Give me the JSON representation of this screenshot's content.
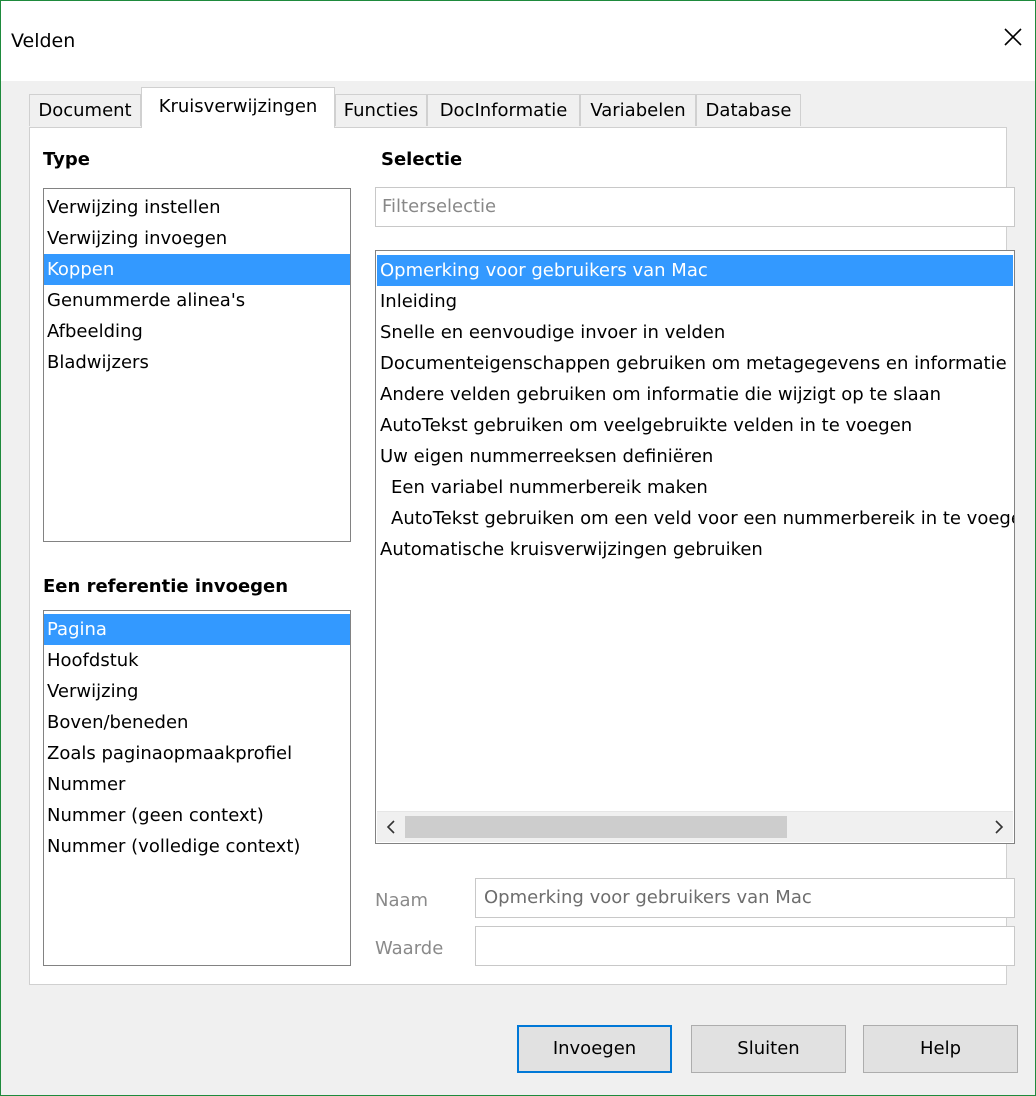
{
  "window": {
    "title": "Velden"
  },
  "tabs": [
    {
      "label": "Document"
    },
    {
      "label": "Kruisverwijzingen"
    },
    {
      "label": "Functies"
    },
    {
      "label": "DocInformatie"
    },
    {
      "label": "Variabelen"
    },
    {
      "label": "Database"
    }
  ],
  "active_tab": "Kruisverwijzingen",
  "type_section": {
    "heading": "Type",
    "items": [
      {
        "label": "Verwijzing instellen"
      },
      {
        "label": "Verwijzing invoegen"
      },
      {
        "label": "Koppen"
      },
      {
        "label": "Genummerde alinea's"
      },
      {
        "label": "Afbeelding"
      },
      {
        "label": "Bladwijzers"
      }
    ],
    "selected": "Koppen"
  },
  "insert_ref_section": {
    "heading": "Een referentie invoegen",
    "items": [
      {
        "label": "Pagina"
      },
      {
        "label": "Hoofdstuk"
      },
      {
        "label": "Verwijzing"
      },
      {
        "label": "Boven/beneden"
      },
      {
        "label": "Zoals paginaopmaakprofiel"
      },
      {
        "label": "Nummer"
      },
      {
        "label": "Nummer (geen context)"
      },
      {
        "label": "Nummer (volledige context)"
      }
    ],
    "selected": "Pagina"
  },
  "selection_section": {
    "heading": "Selectie",
    "filter_placeholder": "Filterselectie",
    "items": [
      {
        "label": "Opmerking voor gebruikers van Mac"
      },
      {
        "label": "Inleiding"
      },
      {
        "label": "Snelle en eenvoudige invoer in velden"
      },
      {
        "label": "Documenteigenschappen gebruiken om metagegevens en informatie"
      },
      {
        "label": "Andere velden gebruiken om informatie die wijzigt op te slaan"
      },
      {
        "label": "AutoTekst gebruiken om veelgebruikte velden in te voegen"
      },
      {
        "label": "Uw eigen nummerreeksen definiëren"
      },
      {
        "label": "Een variabel nummerbereik maken"
      },
      {
        "label": "AutoTekst gebruiken om een veld voor een nummerbereik in te voegen"
      },
      {
        "label": "Automatische kruisverwijzingen gebruiken"
      }
    ],
    "selected": "Opmerking voor gebruikers van Mac"
  },
  "name_field": {
    "label": "Naam",
    "value": "Opmerking voor gebruikers van Mac"
  },
  "value_field": {
    "label": "Waarde",
    "value": ""
  },
  "buttons": {
    "insert": "Invoegen",
    "close": "Sluiten",
    "help": "Help"
  },
  "colors": {
    "selection": "#3399ff",
    "default_button_border": "#0078d7"
  }
}
